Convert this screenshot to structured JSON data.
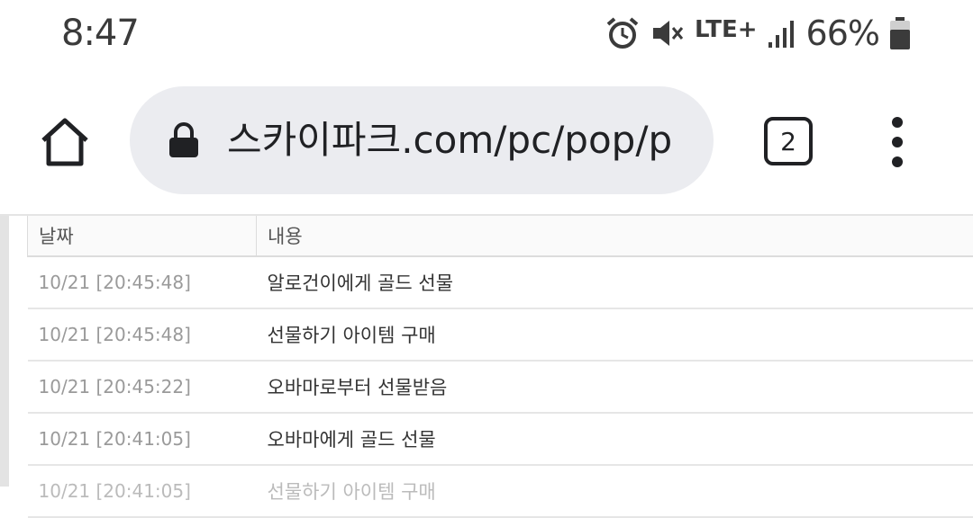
{
  "status_bar": {
    "time": "8:47",
    "network": "LTE+",
    "battery_percent": "66%",
    "icons": [
      "alarm-icon",
      "mute-icon",
      "lte-icon",
      "signal-icon",
      "battery-icon"
    ]
  },
  "toolbar": {
    "url": "스카이파크.com/pc/pop/p",
    "tab_count": "2",
    "icons": [
      "home-icon",
      "lock-icon",
      "tab-switcher-icon",
      "more-menu-icon"
    ]
  },
  "table": {
    "headers": [
      "날짜",
      "내용"
    ],
    "rows": [
      {
        "date": "10/21 [20:45:48]",
        "content": "알로건이에게 골드 선물"
      },
      {
        "date": "10/21 [20:45:48]",
        "content": "선물하기 아이템 구매"
      },
      {
        "date": "10/21 [20:45:22]",
        "content": "오바마로부터 선물받음"
      },
      {
        "date": "10/21 [20:41:05]",
        "content": "오바마에게 골드 선물"
      },
      {
        "date": "10/21 [20:41:05]",
        "content": "선물하기 아이템 구매"
      }
    ]
  }
}
